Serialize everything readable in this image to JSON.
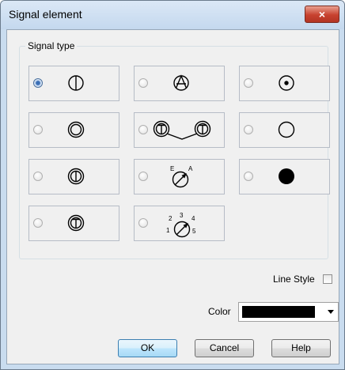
{
  "window": {
    "title": "Signal element",
    "close_icon": "×"
  },
  "signal_type": {
    "label": "Signal type",
    "options": [
      {
        "row": 0,
        "col": 0,
        "symbol": "circle-vertical-line",
        "checked": true
      },
      {
        "row": 0,
        "col": 1,
        "symbol": "circle-with-a",
        "checked": false
      },
      {
        "row": 0,
        "col": 2,
        "symbol": "circle-with-dot",
        "checked": false
      },
      {
        "row": 1,
        "col": 0,
        "symbol": "double-circle",
        "checked": false
      },
      {
        "row": 1,
        "col": 1,
        "symbol": "double-t-circles-connected",
        "checked": false
      },
      {
        "row": 1,
        "col": 2,
        "symbol": "empty-circle",
        "checked": false
      },
      {
        "row": 2,
        "col": 0,
        "symbol": "double-circle-vertical-line",
        "checked": false
      },
      {
        "row": 2,
        "col": 1,
        "symbol": "gauge-e-a",
        "checked": false
      },
      {
        "row": 2,
        "col": 2,
        "symbol": "filled-circle",
        "checked": false
      },
      {
        "row": 3,
        "col": 0,
        "symbol": "double-circle-t",
        "checked": false
      },
      {
        "row": 3,
        "col": 1,
        "symbol": "gauge-1-5",
        "checked": false
      }
    ],
    "gauge_e_a_labels": [
      "E",
      "A"
    ],
    "gauge_1_5_labels": [
      "2",
      "3",
      "4",
      "1",
      "5"
    ]
  },
  "line_style": {
    "label": "Line Style",
    "checked": false
  },
  "color": {
    "label": "Color",
    "value": "#000000"
  },
  "buttons": {
    "ok": "OK",
    "cancel": "Cancel",
    "help": "Help"
  }
}
